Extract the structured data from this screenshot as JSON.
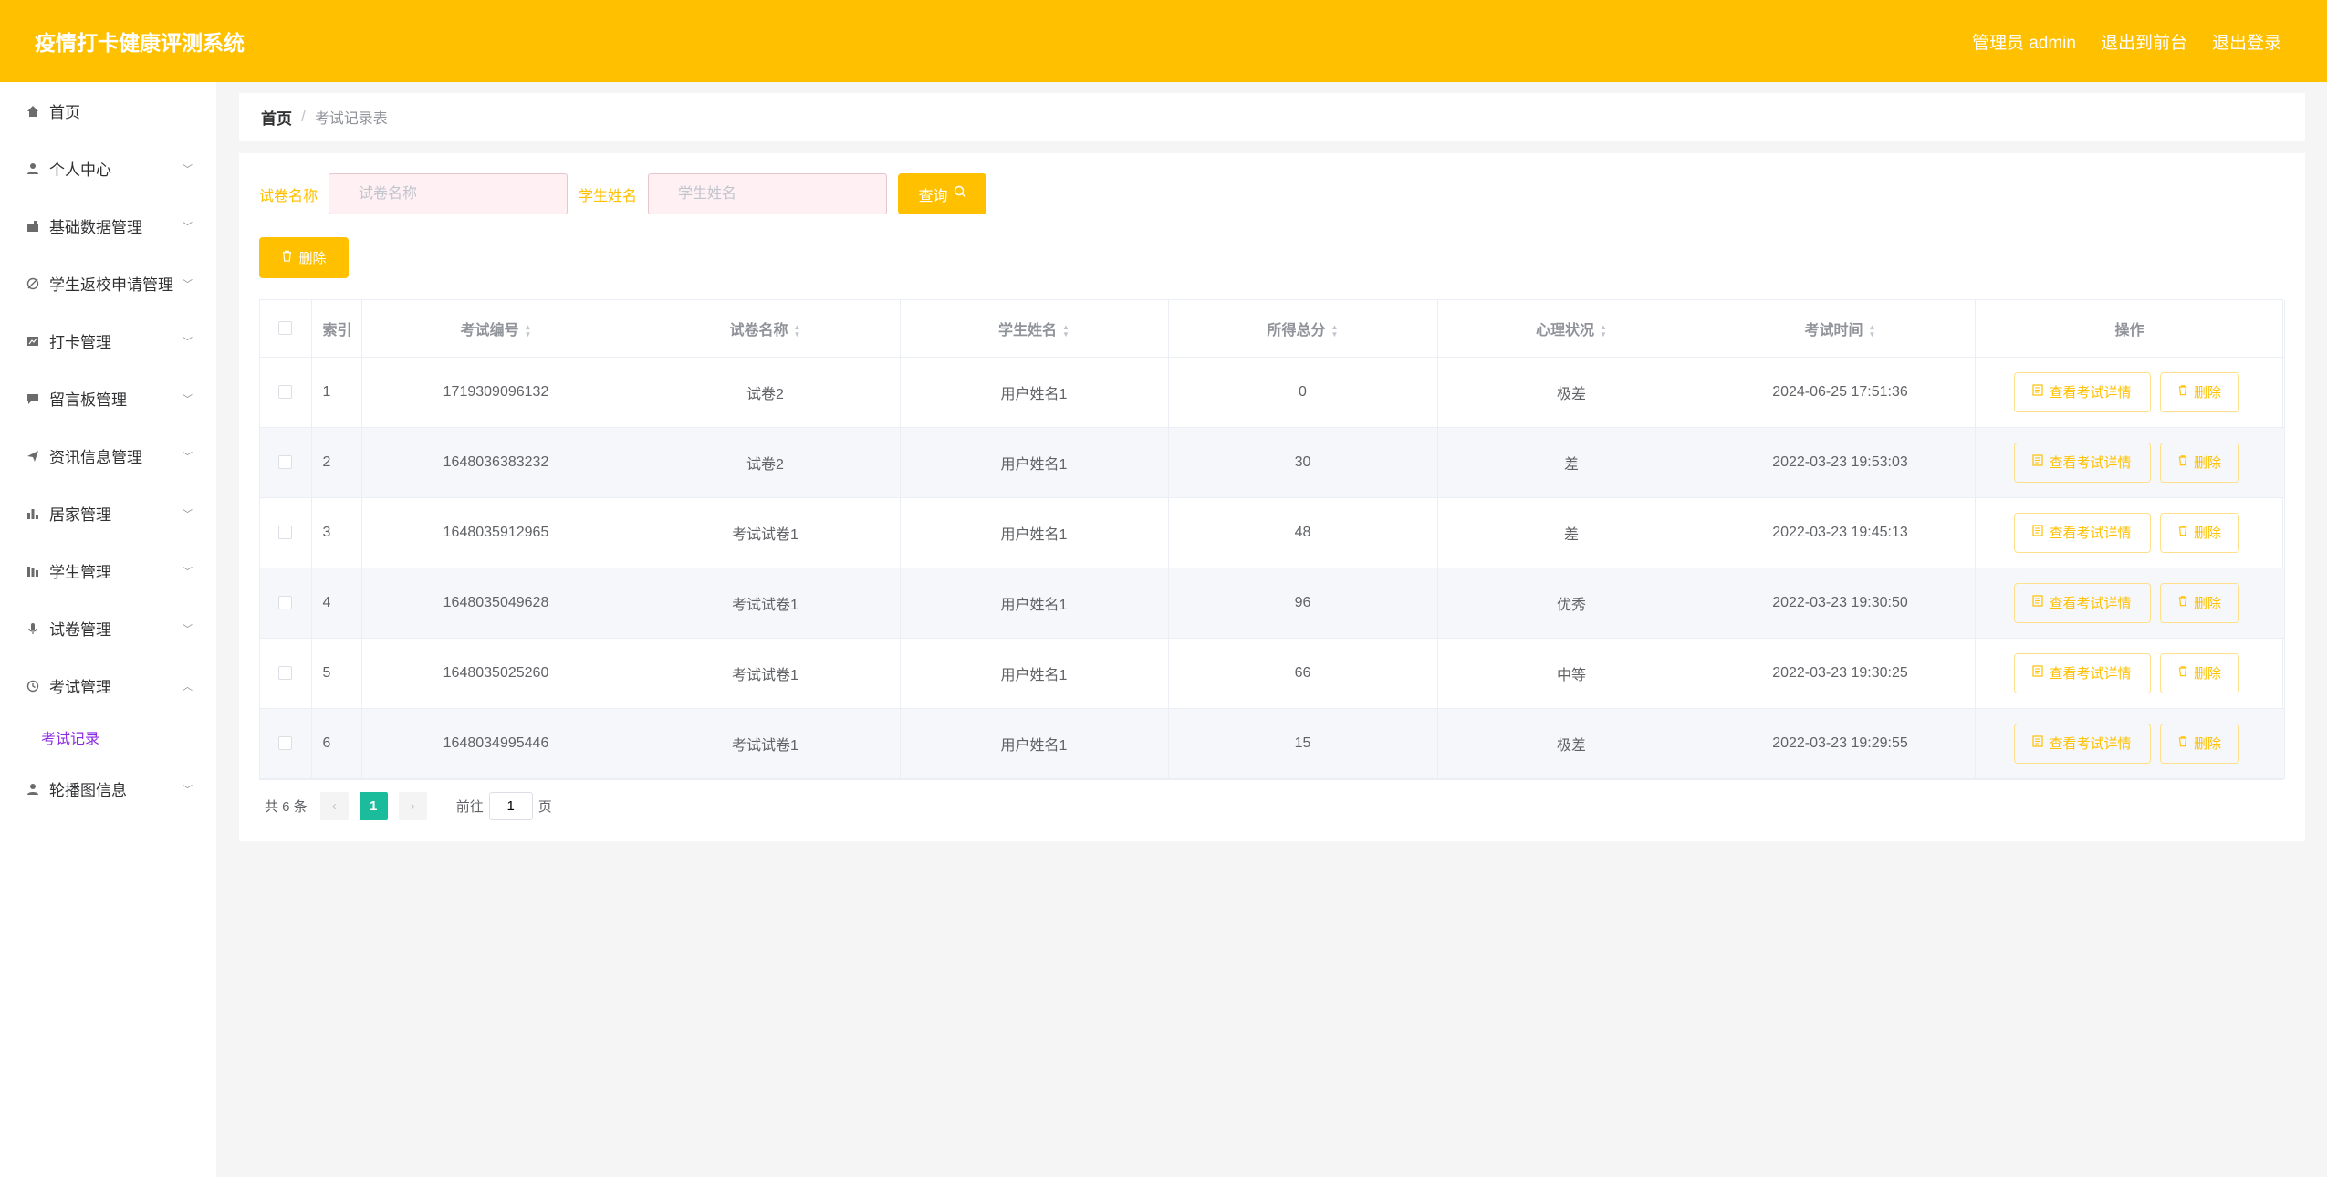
{
  "header": {
    "title": "疫情打卡健康评测系统",
    "admin": "管理员 admin",
    "to_front": "退出到前台",
    "logout": "退出登录"
  },
  "sidebar": {
    "items": [
      {
        "label": "首页",
        "icon": "home-icon"
      },
      {
        "label": "个人中心",
        "icon": "user-icon"
      },
      {
        "label": "基础数据管理",
        "icon": "data-icon"
      },
      {
        "label": "学生返校申请管理",
        "icon": "compass-icon"
      },
      {
        "label": "打卡管理",
        "icon": "chart-icon"
      },
      {
        "label": "留言板管理",
        "icon": "message-icon"
      },
      {
        "label": "资讯信息管理",
        "icon": "send-icon"
      },
      {
        "label": "居家管理",
        "icon": "bar-chart-icon"
      },
      {
        "label": "学生管理",
        "icon": "grid-icon"
      },
      {
        "label": "试卷管理",
        "icon": "mic-icon"
      },
      {
        "label": "考试管理",
        "icon": "clock-icon"
      },
      {
        "label": "轮播图信息",
        "icon": "user-icon"
      }
    ],
    "sub_item": "考试记录"
  },
  "breadcrumb": {
    "home": "首页",
    "sep": "/",
    "current": "考试记录表"
  },
  "search": {
    "paper_label": "试卷名称",
    "paper_placeholder": "试卷名称",
    "student_label": "学生姓名",
    "student_placeholder": "学生姓名",
    "query": "查询"
  },
  "toolbar": {
    "delete": "删除"
  },
  "table": {
    "headers": {
      "index": "索引",
      "exam_no": "考试编号",
      "paper_name": "试卷名称",
      "student_name": "学生姓名",
      "score": "所得总分",
      "mental": "心理状况",
      "exam_time": "考试时间",
      "ops": "操作"
    },
    "view_label": "查看考试详情",
    "delete_label": "删除",
    "rows": [
      {
        "index": "1",
        "exam_no": "1719309096132",
        "paper_name": "试卷2",
        "student_name": "用户姓名1",
        "score": "0",
        "mental": "极差",
        "exam_time": "2024-06-25 17:51:36"
      },
      {
        "index": "2",
        "exam_no": "1648036383232",
        "paper_name": "试卷2",
        "student_name": "用户姓名1",
        "score": "30",
        "mental": "差",
        "exam_time": "2022-03-23 19:53:03"
      },
      {
        "index": "3",
        "exam_no": "1648035912965",
        "paper_name": "考试试卷1",
        "student_name": "用户姓名1",
        "score": "48",
        "mental": "差",
        "exam_time": "2022-03-23 19:45:13"
      },
      {
        "index": "4",
        "exam_no": "1648035049628",
        "paper_name": "考试试卷1",
        "student_name": "用户姓名1",
        "score": "96",
        "mental": "优秀",
        "exam_time": "2022-03-23 19:30:50"
      },
      {
        "index": "5",
        "exam_no": "1648035025260",
        "paper_name": "考试试卷1",
        "student_name": "用户姓名1",
        "score": "66",
        "mental": "中等",
        "exam_time": "2022-03-23 19:30:25"
      },
      {
        "index": "6",
        "exam_no": "1648034995446",
        "paper_name": "考试试卷1",
        "student_name": "用户姓名1",
        "score": "15",
        "mental": "极差",
        "exam_time": "2022-03-23 19:29:55"
      }
    ]
  },
  "pager": {
    "total": "共 6 条",
    "current": "1",
    "goto_prefix": "前往",
    "goto_value": "1",
    "goto_suffix": "页"
  },
  "colors": {
    "accent": "#ffc000",
    "pager_active": "#1abc9c",
    "submenu": "#8a2be2"
  }
}
